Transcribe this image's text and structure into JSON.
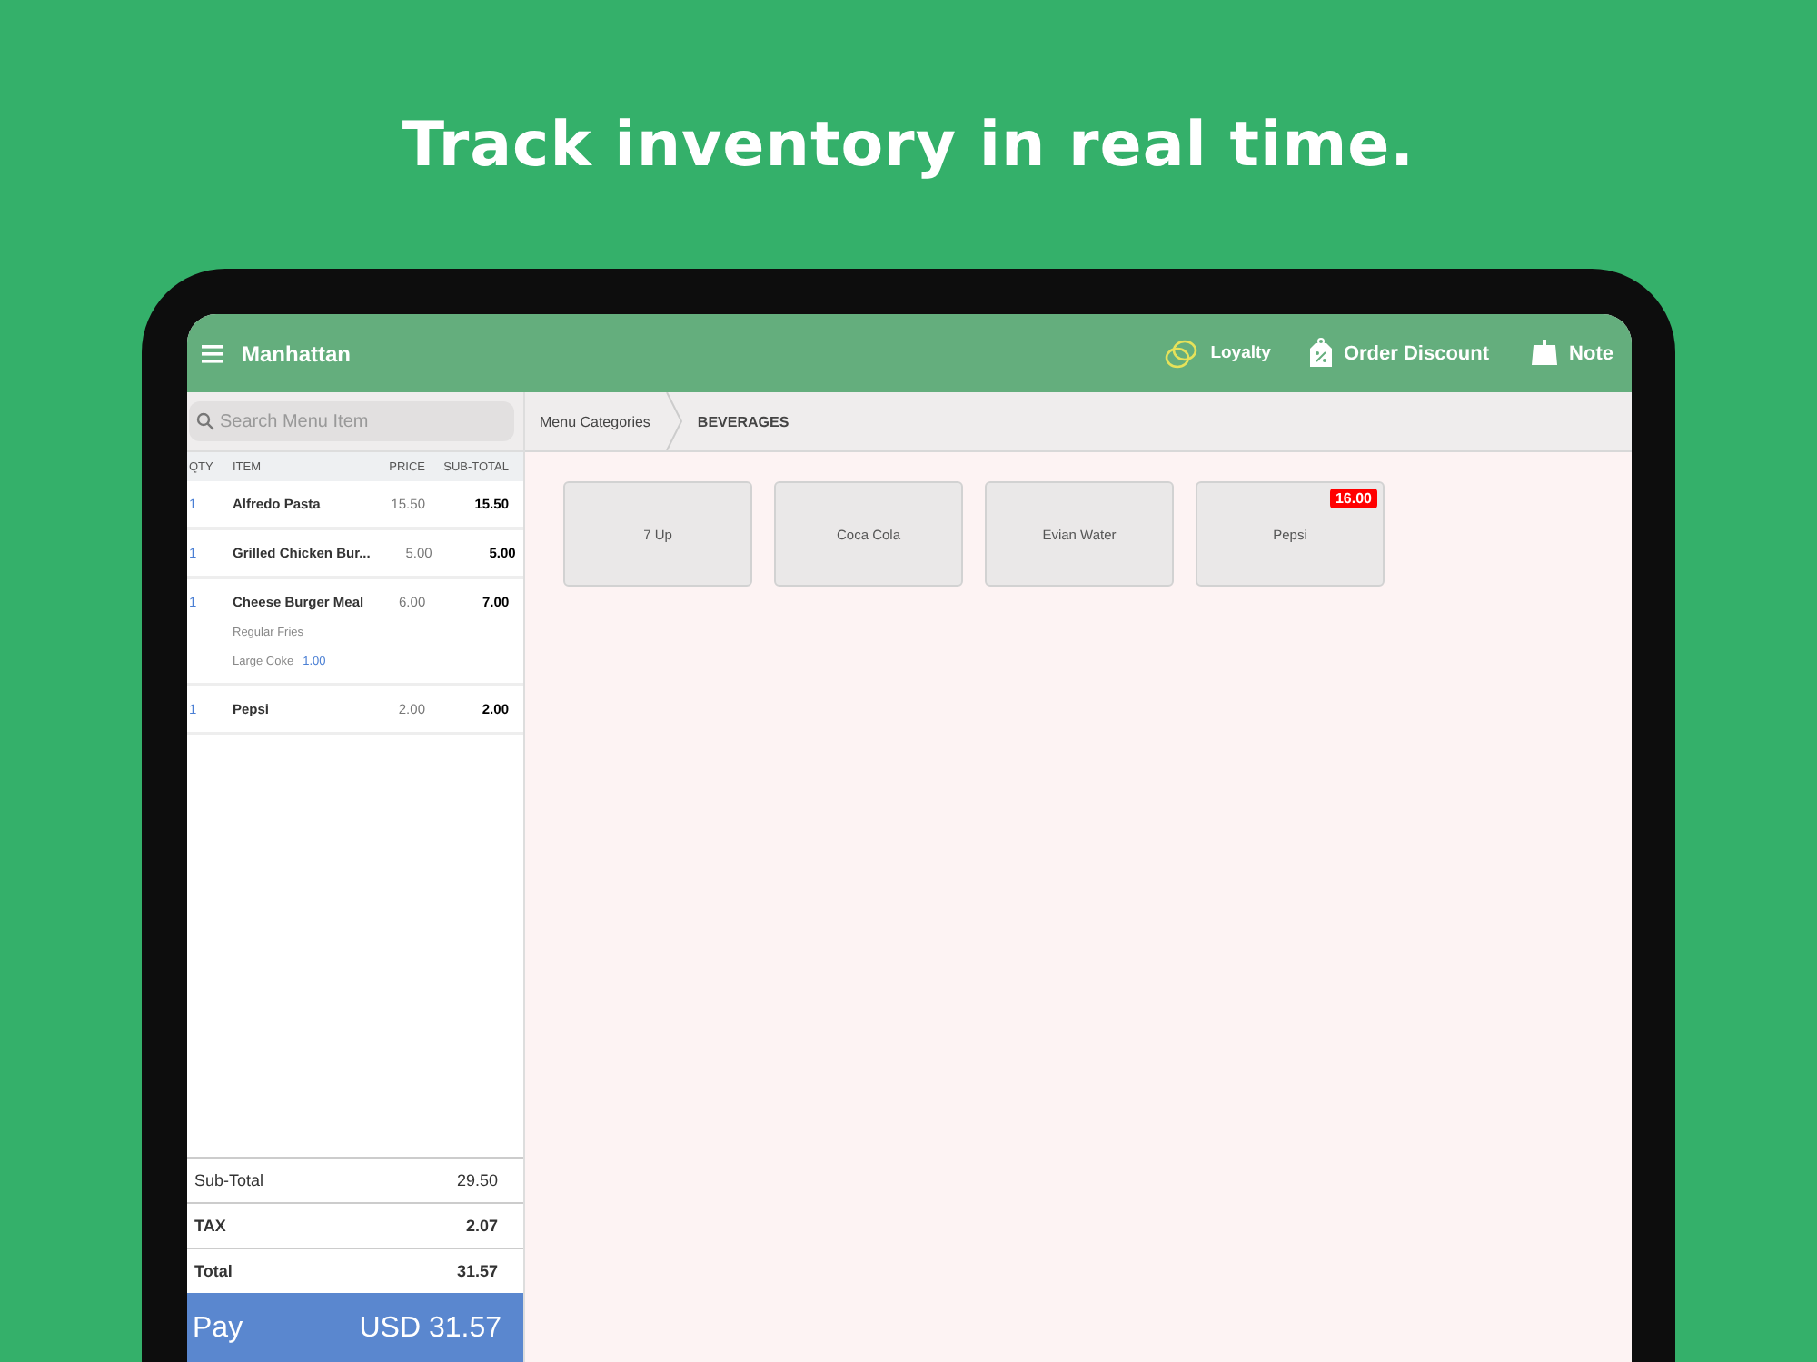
{
  "headline": "Track inventory in real time.",
  "app": {
    "location": "Manhattan",
    "actions": [
      {
        "kind": "loyalty",
        "label": "Loyalty"
      },
      {
        "kind": "discount",
        "label": "Order Discount"
      },
      {
        "kind": "note",
        "label": "Note"
      }
    ],
    "search": {
      "placeholder": "Search Menu Item"
    },
    "columns": [
      "QTY",
      "ITEM",
      "PRICE",
      "SUB-TOTAL"
    ],
    "order_items": [
      {
        "qty": "1",
        "item": "Alfredo Pasta",
        "price": "15.50",
        "subtotal": "15.50"
      },
      {
        "qty": "1",
        "item": "Grilled Chicken Bur...",
        "price": "5.00",
        "subtotal": "5.00"
      },
      {
        "qty": "1",
        "item": "Cheese Burger Meal",
        "price": "6.00",
        "subtotal": "7.00",
        "modifiers": [
          {
            "name": "Regular Fries"
          },
          {
            "name": "Large Coke",
            "price": "1.00"
          }
        ]
      },
      {
        "qty": "1",
        "item": "Pepsi",
        "price": "2.00",
        "subtotal": "2.00"
      }
    ],
    "totals": [
      {
        "label": "Sub-Total",
        "value": "29.50",
        "bold": false
      },
      {
        "label": "TAX",
        "value": "2.07",
        "bold": true
      },
      {
        "label": "Total",
        "value": "31.57",
        "bold": true
      }
    ],
    "pay": {
      "label": "Pay",
      "amount": "USD 31.57"
    },
    "breadcrumb": [
      "Menu Categories",
      "BEVERAGES"
    ],
    "products": [
      {
        "name": "7 Up"
      },
      {
        "name": "Coca Cola"
      },
      {
        "name": "Evian Water"
      },
      {
        "name": "Pepsi",
        "badge": "16.00"
      }
    ]
  }
}
